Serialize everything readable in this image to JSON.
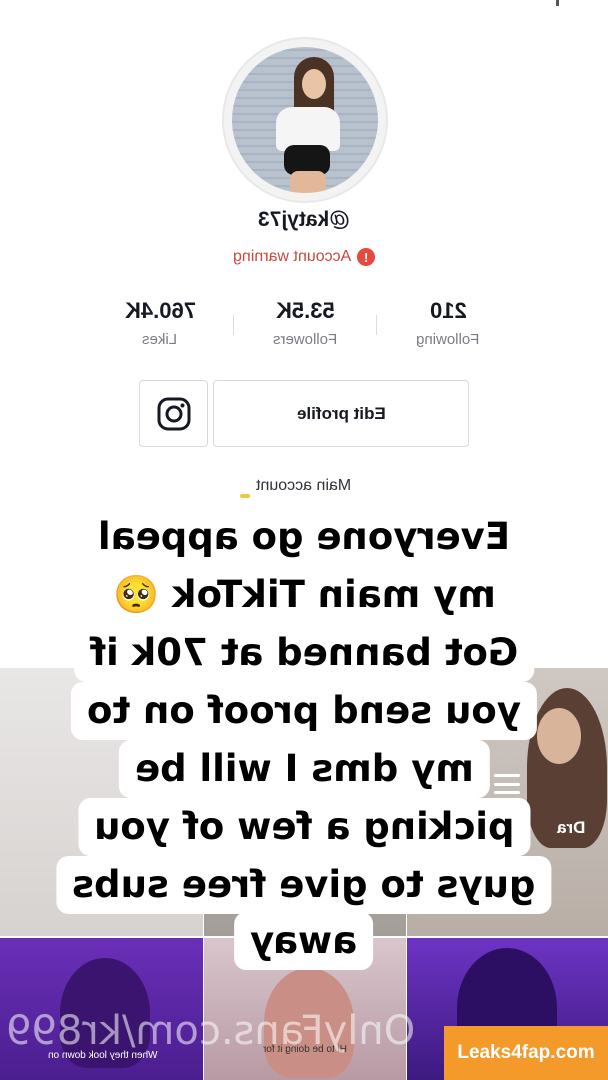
{
  "profile": {
    "username": "@katyj73",
    "warning_label": "Account warning",
    "warning_icon": "!",
    "edit_profile_label": "Edit profile",
    "main_account_label": "Main account"
  },
  "stats": [
    {
      "value": "210",
      "label": "Following"
    },
    {
      "value": "53.5K",
      "label": "Followers"
    },
    {
      "value": "760.4K",
      "label": "Likes"
    }
  ],
  "caption_lines": [
    "Everyone go appeal",
    "my main TikTok 🥺",
    "Got banned at 70k if",
    "you send proof on to",
    "my dms I will be",
    "picking a few of you",
    "guys to give free subs",
    "away"
  ],
  "tiles": {
    "tile_3_text": "Dra",
    "tile_4_caption": "When they look down on",
    "tile_5_caption": "Hi to be doing it for"
  },
  "watermark": "OnlyFans.com/kr899",
  "badge": "Leaks4fap.com",
  "colors": {
    "warning": "#c94a3d",
    "badge": "#f39a2b",
    "purple_tile": "#6a2fb8"
  },
  "icons": {
    "instagram": "instagram-icon",
    "warning": "warning-icon",
    "menu": "menu-icon",
    "play": "play-icon"
  }
}
